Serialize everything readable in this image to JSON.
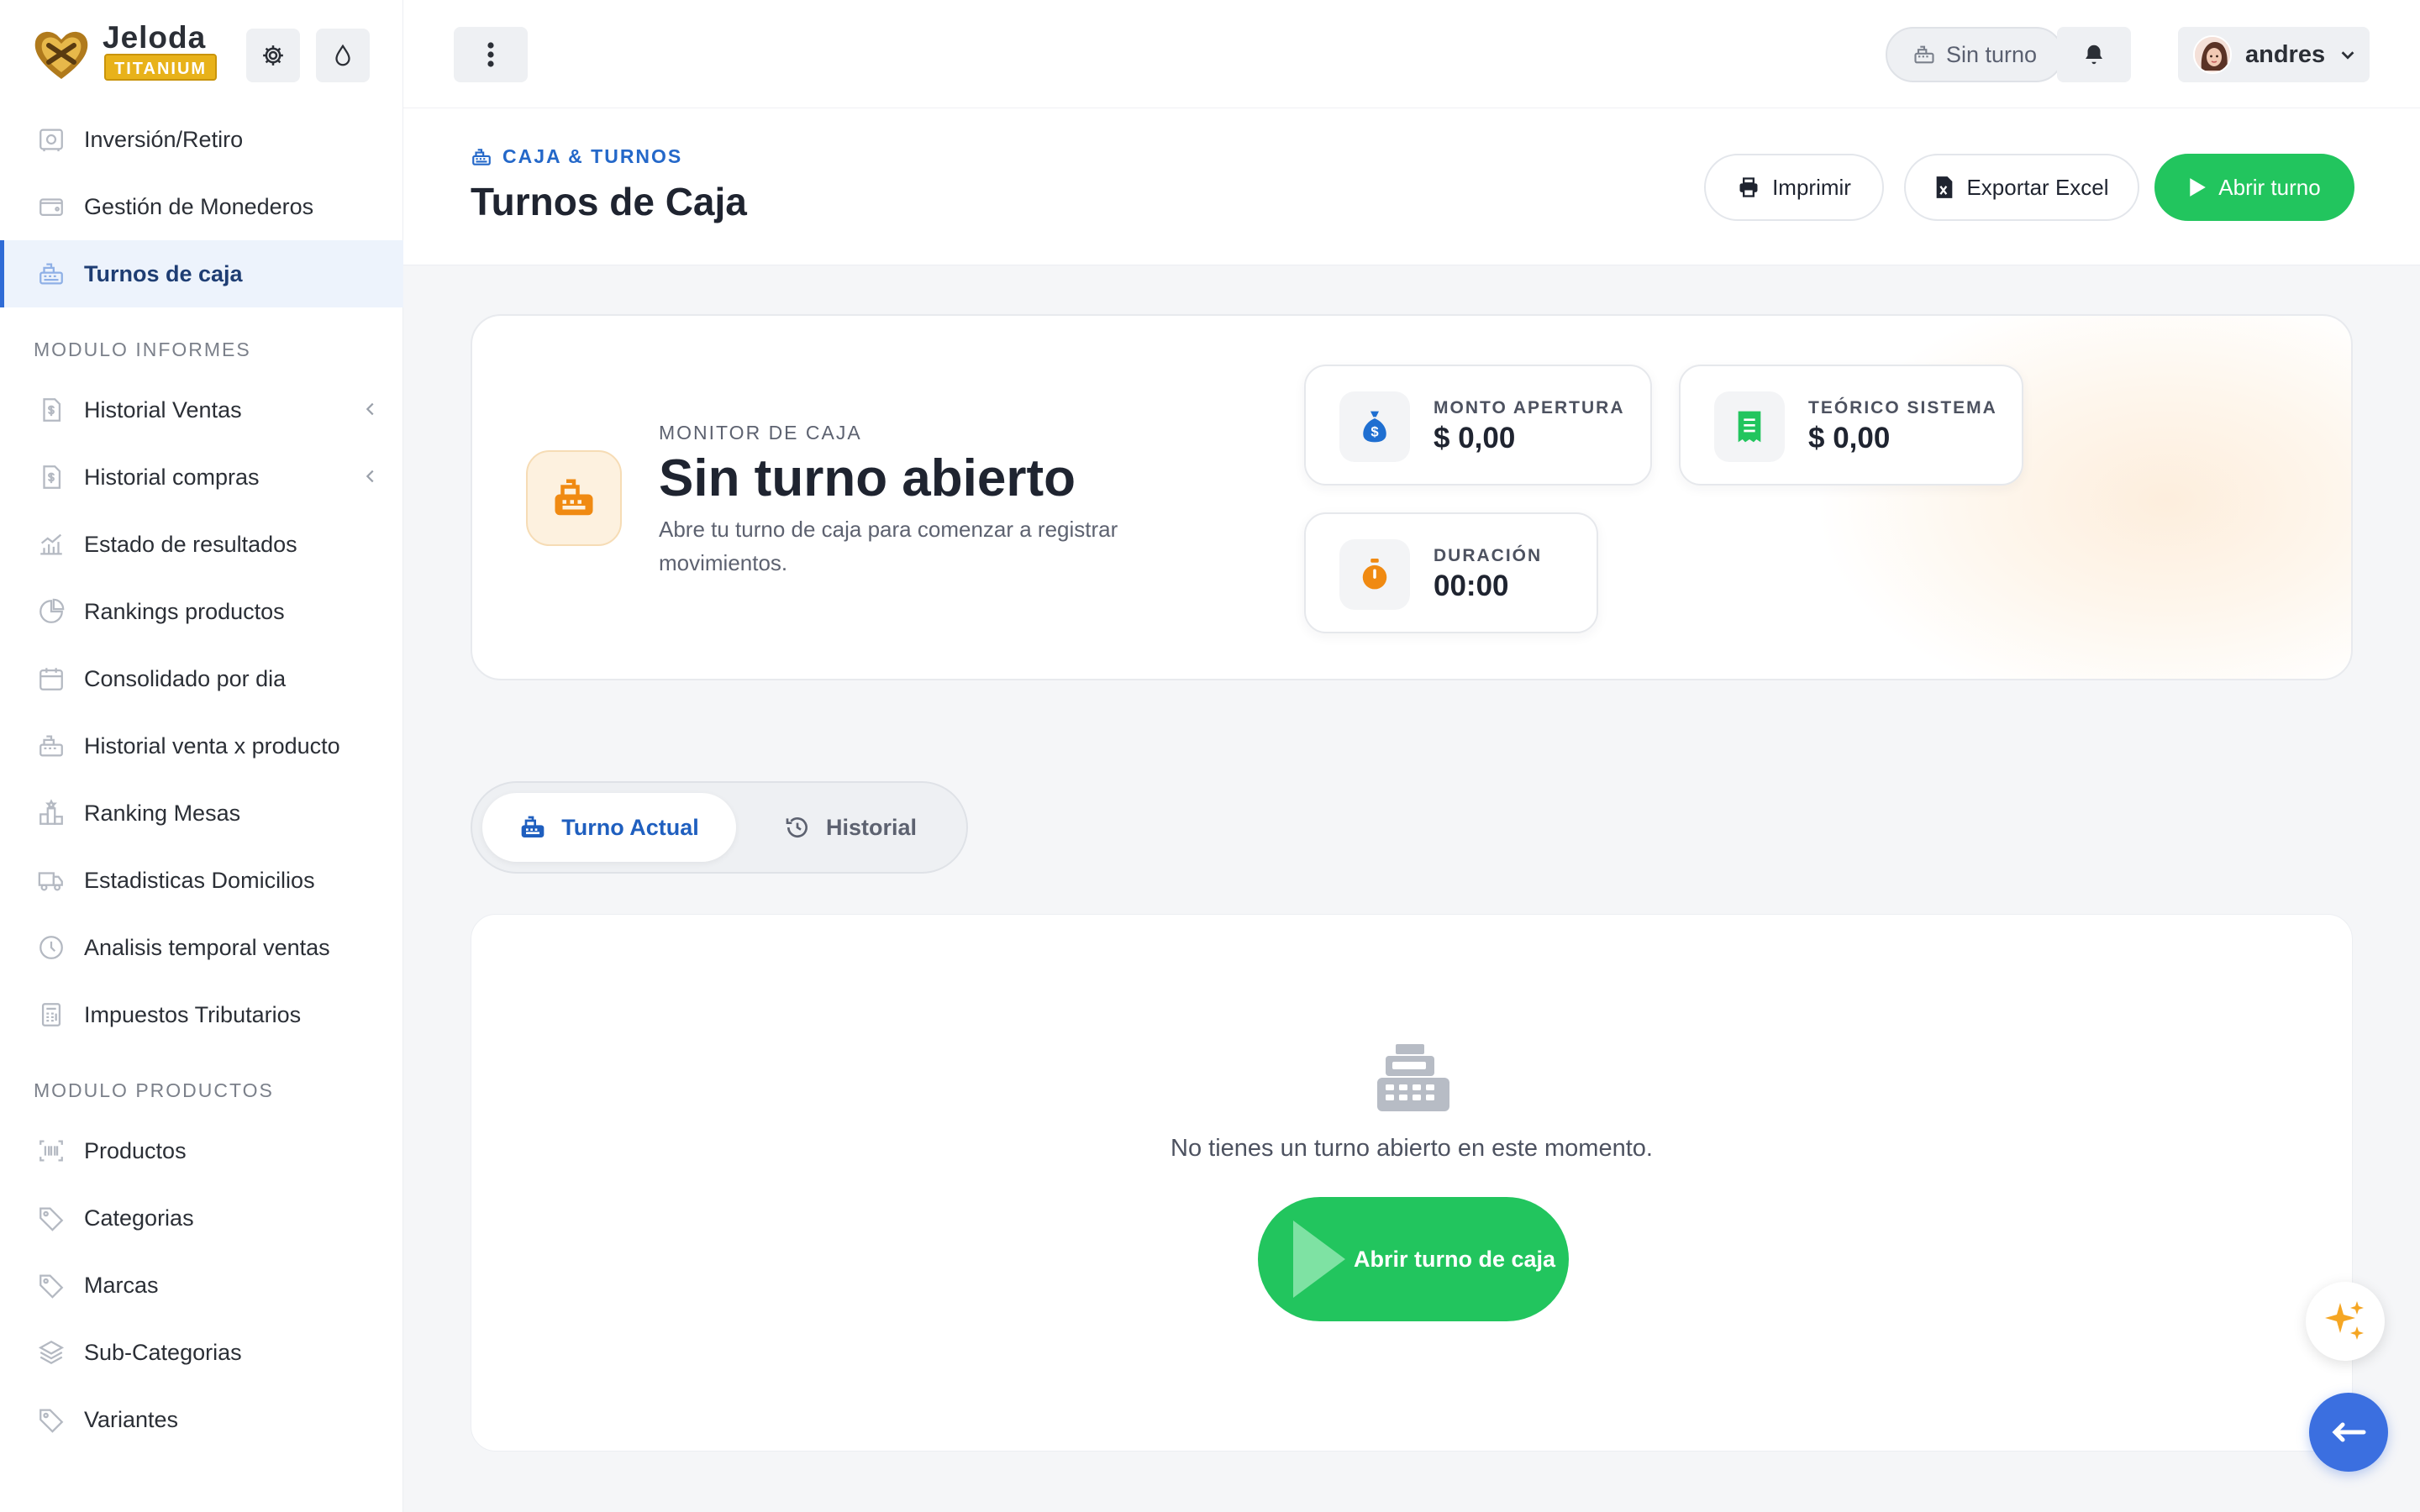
{
  "brand": {
    "name": "Jeloda",
    "badge": "TITANIUM"
  },
  "sidebar": {
    "top_items": [
      {
        "label": "Inversión/Retiro",
        "icon": "safe-icon"
      },
      {
        "label": "Gestión de Monederos",
        "icon": "wallet-icon"
      },
      {
        "label": "Turnos de caja",
        "icon": "cash-register-icon",
        "active": true
      }
    ],
    "sections": [
      {
        "title": "MODULO INFORMES",
        "items": [
          {
            "label": "Historial Ventas",
            "icon": "receipt-dollar-icon",
            "has_submenu": true
          },
          {
            "label": "Historial compras",
            "icon": "receipt-dollar-icon",
            "has_submenu": true
          },
          {
            "label": "Estado de resultados",
            "icon": "chart-growth-icon"
          },
          {
            "label": "Rankings productos",
            "icon": "pie-chart-icon"
          },
          {
            "label": "Consolidado por dia",
            "icon": "calendar-icon"
          },
          {
            "label": "Historial venta x producto",
            "icon": "cash-register-icon"
          },
          {
            "label": "Ranking Mesas",
            "icon": "podium-icon"
          },
          {
            "label": "Estadisticas Domicilios",
            "icon": "delivery-truck-icon"
          },
          {
            "label": "Analisis temporal ventas",
            "icon": "clock-icon"
          },
          {
            "label": "Impuestos Tributarios",
            "icon": "calculator-icon"
          }
        ]
      },
      {
        "title": "MODULO PRODUCTOS",
        "items": [
          {
            "label": "Productos",
            "icon": "barcode-icon"
          },
          {
            "label": "Categorias",
            "icon": "tag-icon"
          },
          {
            "label": "Marcas",
            "icon": "tag-icon"
          },
          {
            "label": "Sub-Categorias",
            "icon": "layers-icon"
          },
          {
            "label": "Variantes",
            "icon": "tag-icon"
          }
        ]
      }
    ]
  },
  "topbar": {
    "shift_status": "Sin turno",
    "user_name": "andres"
  },
  "header": {
    "eyebrow": "CAJA & TURNOS",
    "title": "Turnos de Caja",
    "print_label": "Imprimir",
    "export_label": "Exportar Excel",
    "open_label": "Abrir turno"
  },
  "monitor": {
    "kicker": "MONITOR DE CAJA",
    "title": "Sin turno abierto",
    "description": "Abre tu turno de caja para comenzar a registrar movimientos.",
    "stats": [
      {
        "label": "MONTO APERTURA",
        "value": "$ 0,00",
        "icon": "money-bag-icon",
        "color": "#1f6fd1"
      },
      {
        "label": "TEÓRICO SISTEMA",
        "value": "$ 0,00",
        "icon": "receipt-icon",
        "color": "#22c55e"
      },
      {
        "label": "DURACIÓN",
        "value": "00:00",
        "icon": "stopwatch-icon",
        "color": "#f08a12"
      }
    ]
  },
  "tabs": [
    {
      "label": "Turno Actual",
      "icon": "cash-register-icon",
      "active": true
    },
    {
      "label": "Historial",
      "icon": "history-icon",
      "active": false
    }
  ],
  "empty_state": {
    "message": "No tienes un turno abierto en este momento.",
    "cta_label": "Abrir turno de caja"
  },
  "colors": {
    "primary_blue": "#2f6bd6",
    "success_green": "#22c55e",
    "accent_orange": "#f08a12",
    "badge_gold": "#e8b21a"
  }
}
